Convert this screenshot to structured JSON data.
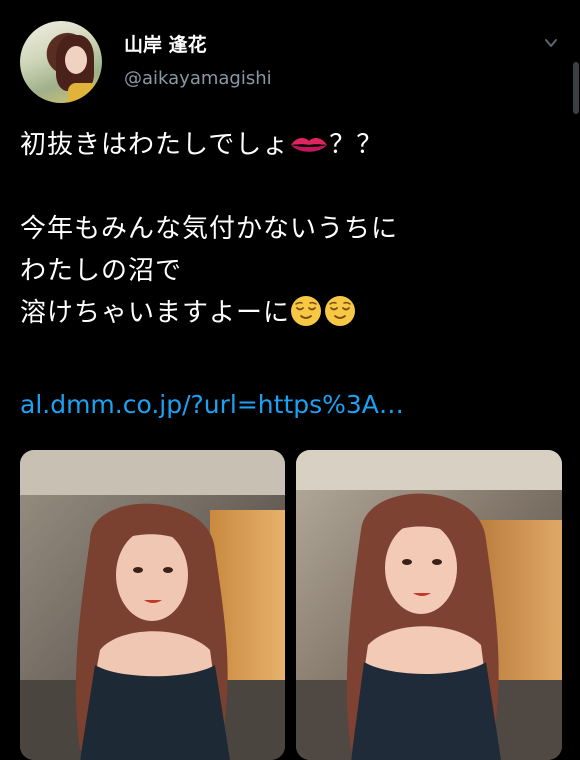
{
  "tweet": {
    "author_name": "山岸 逢花",
    "author_handle": "@aikayamagishi",
    "lines": [
      "初抜きはわたしでしょ",
      "？？",
      "今年もみんな気付かないうちに",
      "わたしの沼で",
      "溶けちゃいますよーに"
    ],
    "link": "al.dmm.co.jp/?url=https%3A…"
  },
  "icons": {
    "menu": "chevron-down-icon",
    "lips": "kiss-mark-emoji",
    "relieved": "relieved-face-emoji"
  },
  "colors": {
    "background": "#000000",
    "link": "#1da1f2",
    "handle": "#8899a6"
  }
}
